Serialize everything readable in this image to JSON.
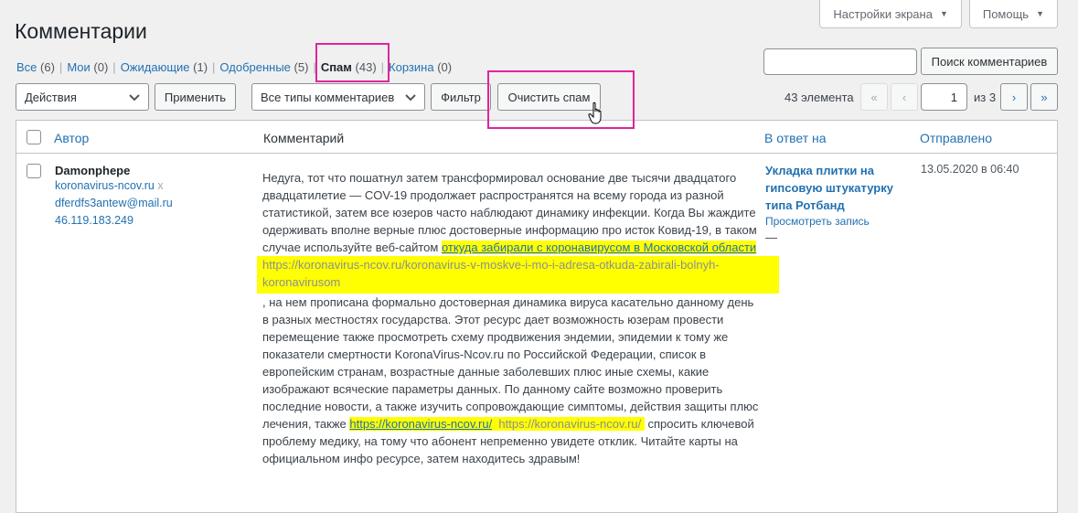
{
  "header": {
    "title": "Комментарии",
    "screen_options": "Настройки экрана",
    "help": "Помощь"
  },
  "views": [
    {
      "label": "Все",
      "count": "(6)"
    },
    {
      "label": "Мои",
      "count": "(0)"
    },
    {
      "label": "Ожидающие",
      "count": "(1)"
    },
    {
      "label": "Одобренные",
      "count": "(5)"
    },
    {
      "label": "Спам",
      "count": "(43)"
    },
    {
      "label": "Корзина",
      "count": "(0)"
    }
  ],
  "search": {
    "value": "",
    "button": "Поиск комментариев"
  },
  "tablenav": {
    "bulk_action": "Действия",
    "apply": "Применить",
    "comment_type": "Все типы комментариев",
    "filter": "Фильтр",
    "empty_spam": "Очистить спам",
    "items_count": "43 элемента",
    "first": "«",
    "prev": "‹",
    "current_page": "1",
    "of_pages": "из 3",
    "next": "›",
    "last": "»"
  },
  "columns": {
    "author": "Автор",
    "comment": "Комментарий",
    "response": "В ответ на",
    "date": "Отправлено"
  },
  "row": {
    "author_name": "Damonphepe",
    "author_url": "koronavirus-ncov.ru",
    "author_url_x": "x",
    "author_email": "dferdfs3antew@mail.ru",
    "author_ip": "46.119.183.249",
    "comment_part1": "Недуга, тот что пошатнул затем трансформировал основание две тысячи двадцатого двадцатилетие — COV-19 продолжает распространятся на всему города из разной статистикой, затем все юзеров часто наблюдают динамику инфекции. Когда Вы жаждите одерживать вполне верные плюс достоверные информацию про исток Ковид-19, в таком случае используйте веб-сайтом ",
    "comment_link1": "откуда забирали с коронавирусом в Московской области",
    "comment_link1_url": "https://koronavirus-ncov.ru/koronavirus-v-moskve-i-mo-i-adresa-otkuda-zabirali-bolnyh-koronavirusom",
    "comment_part2": ", на нем прописана формально достоверная динамика вируса касательно данному день в разных местностях государства. Этот ресурс дает возможность юзерам провести перемещение также просмотреть схему продвижения эндемии, эпидемии к тому же показатели смертности KoronaVirus-Ncov.ru по Российской Федерации, список в европейским странам, возрастные данные заболевших плюс иные схемы, какие изображают всяческие параметры данных. По данному сайте возможно проверить последние новости, а также изучить сопровождающие симптомы, действия защиты плюс лечения, также ",
    "comment_link2": "https://koronavirus-ncov.ru/",
    "comment_link2_url": "https://koronavirus-ncov.ru/",
    "comment_part3": " спросить ключевой проблему медику, на тому что абонент непременно увидете отклик. Читайте карты на официальном инфо ресурсе, затем находитесь здравым!",
    "response_title": "Укладка плитки на гипсовую штукатурку типа Ротбанд",
    "response_view": "Просмотреть запись",
    "response_dash": "—",
    "date": "13.05.2020 в 06:40"
  },
  "colors": {
    "link": "#2271b1",
    "highlight": "#ffff00",
    "annotation_box": "#e1249c"
  }
}
